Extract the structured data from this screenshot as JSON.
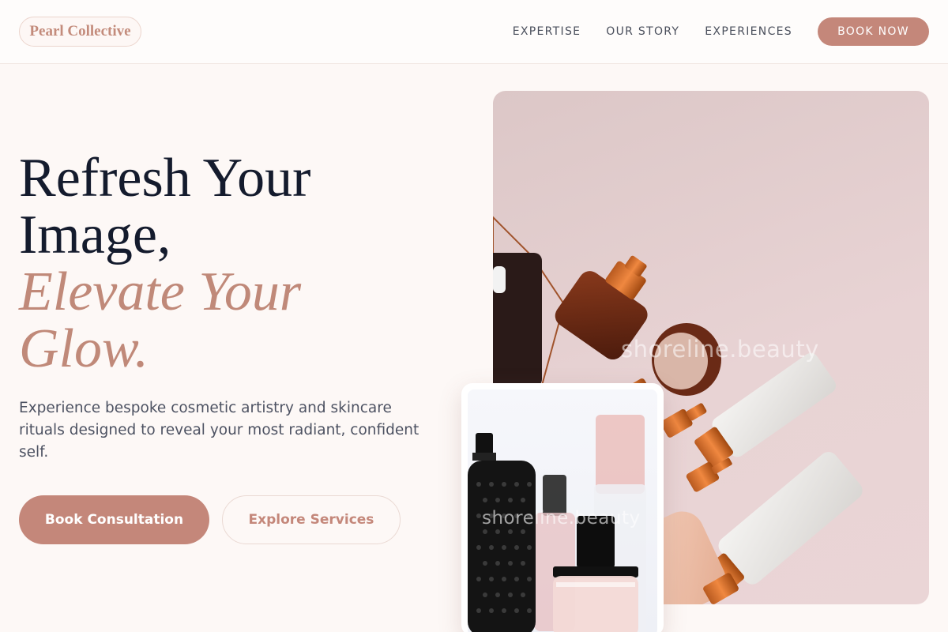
{
  "header": {
    "logo": "Pearl Collective",
    "nav": [
      "EXPERTISE",
      "OUR STORY",
      "EXPERIENCES"
    ],
    "cta": "BOOK NOW"
  },
  "hero": {
    "title_line1": "Refresh Your",
    "title_line2": "Image,",
    "accent_line1": "Elevate Your",
    "accent_line2": "Glow.",
    "description": "Experience bespoke cosmetic artistry and skincare rituals designed to reveal your most radiant, confident self.",
    "primary_button": "Book Consultation",
    "secondary_button": "Explore Services"
  },
  "images": {
    "main_watermark": "shoreline.beauty",
    "card_watermark": "shoreline.beauty"
  },
  "colors": {
    "accent": "#c4877a",
    "background": "#fdf8f6",
    "heading": "#141b2d"
  }
}
